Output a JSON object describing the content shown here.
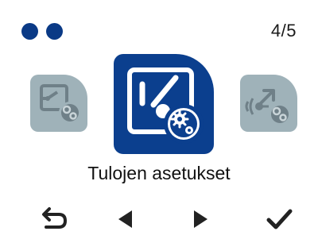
{
  "status": {
    "page_indicator": "4/5",
    "dots": 2
  },
  "carousel": {
    "title": "Tulojen asetukset",
    "selected_index": 1,
    "items": [
      {
        "icon": "switch-settings-icon"
      },
      {
        "icon": "input-settings-icon"
      },
      {
        "icon": "wireless-settings-icon"
      }
    ]
  },
  "navbar": {
    "items": [
      {
        "icon": "back-icon"
      },
      {
        "icon": "previous-arrow-icon"
      },
      {
        "icon": "next-arrow-icon"
      },
      {
        "icon": "confirm-check-icon"
      }
    ]
  },
  "colors": {
    "accent": "#0b3f8e",
    "dot": "#0a3a86",
    "tile_inactive": "#9fb2b9",
    "icon_inactive": "#6f8088",
    "text": "#111111",
    "nav_icon": "#222222"
  }
}
